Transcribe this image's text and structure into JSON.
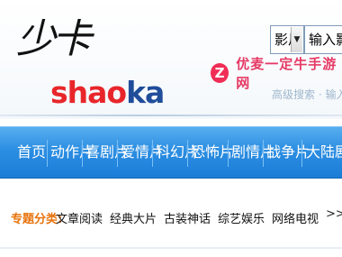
{
  "header": {
    "logo_cn": "少卡",
    "logo_en_a": "shao",
    "logo_en_b": "ka"
  },
  "search": {
    "type_selected": "影片",
    "placeholder": "输入影片"
  },
  "watermark": {
    "icon_glyph": "Z",
    "text": "优麦一定牛手游网"
  },
  "subtext": "高级搜索 · 输入关键",
  "nav": {
    "items": [
      "首页",
      "动作片",
      "喜剧片",
      "爱情片",
      "科幻片",
      "恐怖片",
      "剧情片",
      "战争片",
      "大陆剧"
    ]
  },
  "topics": {
    "label": "专题分类:",
    "links": [
      "文章阅读",
      "经典大片",
      "古装神话",
      "综艺娱乐",
      "网络电视"
    ],
    "more": ">>"
  },
  "colors": {
    "nav_bg": "#2c8ee2",
    "topic_label": "#e8720c",
    "logo_red": "#e8262a",
    "logo_blue": "#1f4d9a",
    "watermark": "#e63a65"
  }
}
